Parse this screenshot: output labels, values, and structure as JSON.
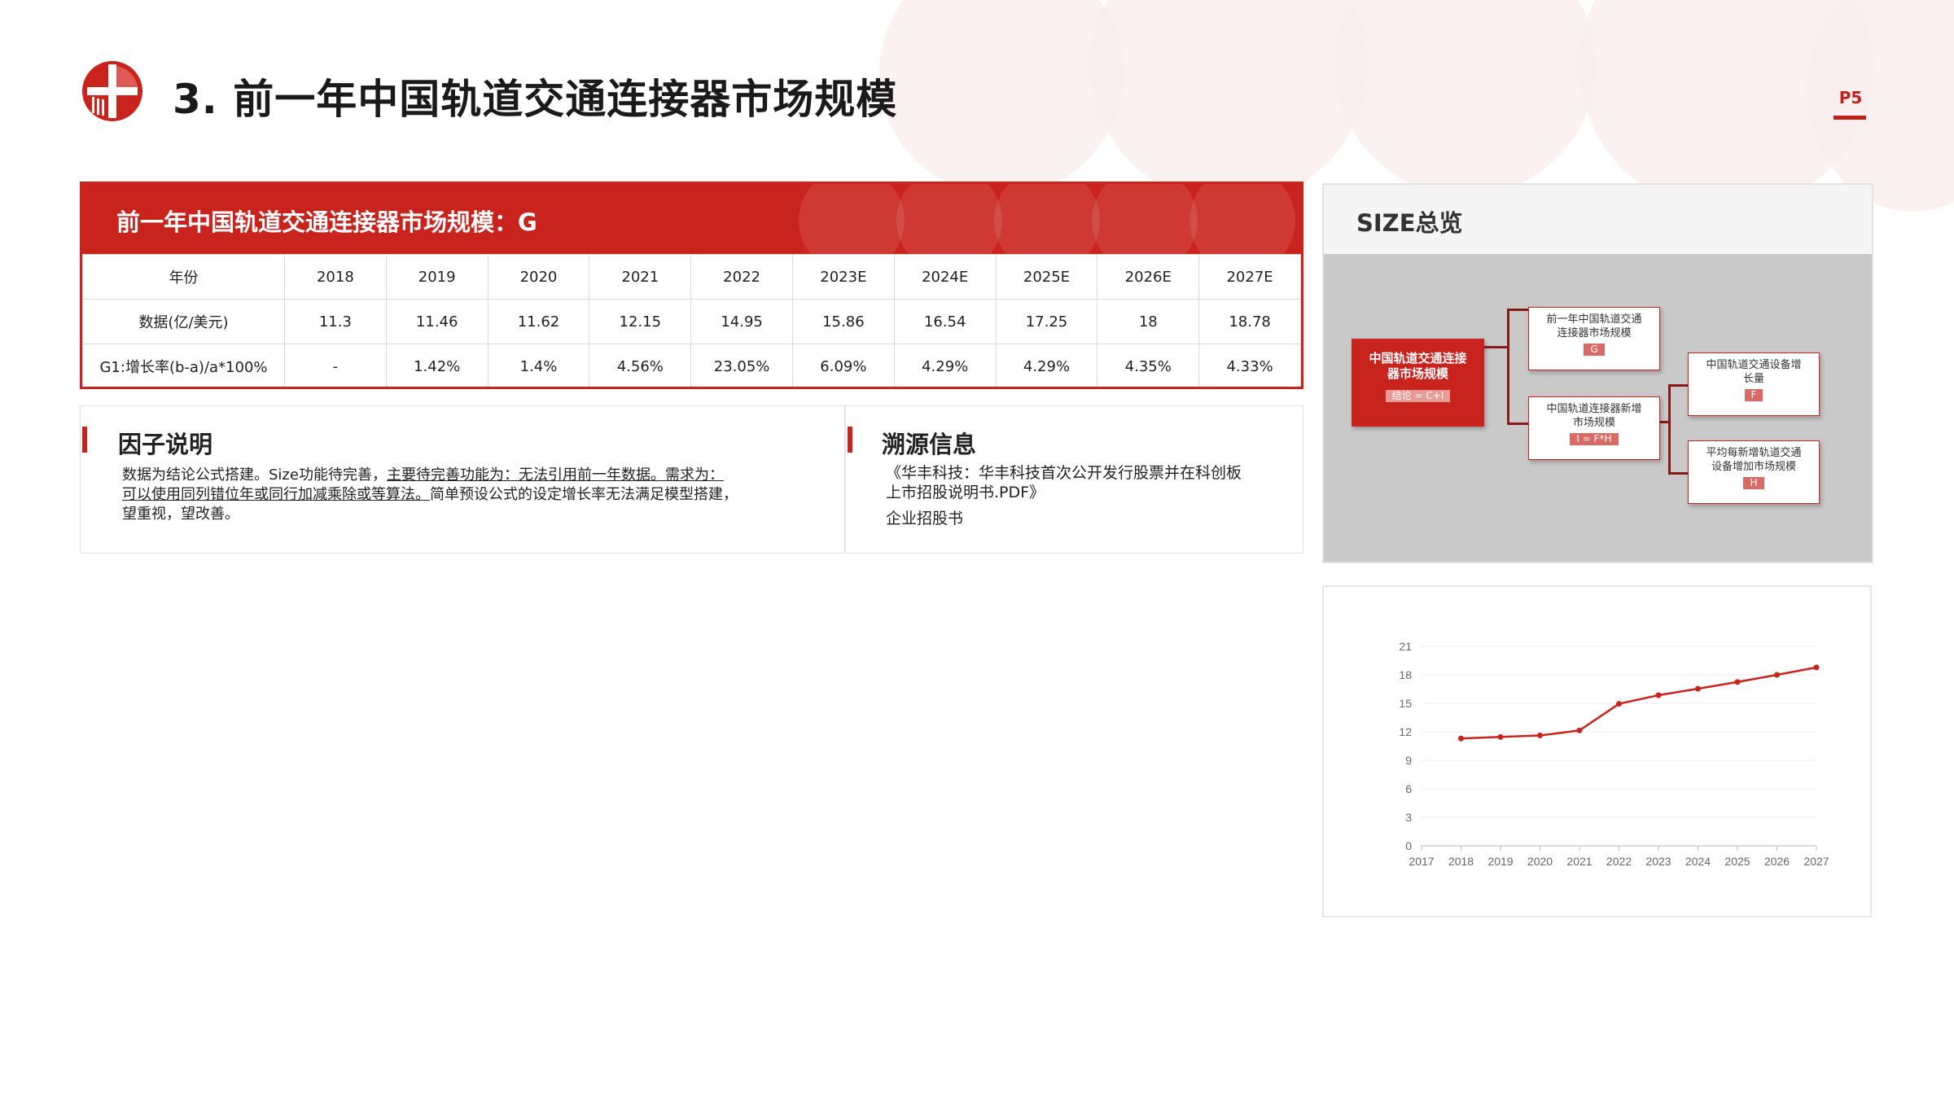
{
  "header": {
    "title": "3.  前一年中国轨道交通连接器市场规模",
    "page": "P5"
  },
  "table": {
    "heading": "前一年中国轨道交通连接器市场规模：G",
    "columns": [
      "年份",
      "2018",
      "2019",
      "2020",
      "2021",
      "2022",
      "2023E",
      "2024E",
      "2025E",
      "2026E",
      "2027E"
    ],
    "rows": [
      [
        "数据(亿/美元)",
        "11.3",
        "11.46",
        "11.62",
        "12.15",
        "14.95",
        "15.86",
        "16.54",
        "17.25",
        "18",
        "18.78"
      ],
      [
        "G1:增长率(b-a)/a*100%",
        "-",
        "1.42%",
        "1.4%",
        "4.56%",
        "23.05%",
        "6.09%",
        "4.29%",
        "4.29%",
        "4.35%",
        "4.33%"
      ]
    ]
  },
  "factor": {
    "title": "因子说明",
    "text_plain1": "数据为结论公式搭建。Size功能待完善，",
    "text_ul1": "主要待完善功能为：无法引用前一年数据。需求为：",
    "text_ul2": "可以使用同列错位年或同行加减乘除或等算法。",
    "text_plain2": "简单预设公式的设定增长率无法满足模型搭建，",
    "text_plain3": "望重视，望改善。"
  },
  "source": {
    "title": "溯源信息",
    "line1": "《华丰科技：华丰科技首次公开发行股票并在科创板",
    "line2": "上市招股说明书.PDF》",
    "line3": "企业招股书"
  },
  "size": {
    "title": "SIZE总览",
    "root": {
      "label1": "中国轨道交通连接",
      "label2": "器市场规模",
      "formula": "结论 = C+I"
    },
    "node_g": {
      "label1": "前一年中国轨道交通",
      "label2": "连接器市场规模",
      "formula": "G"
    },
    "node_i": {
      "label1": "中国轨道连接器新增",
      "label2": "市场规模",
      "formula": "I = F*H"
    },
    "node_f": {
      "label1": "中国轨道交通设备增",
      "label2": "长量",
      "formula": "F"
    },
    "node_h": {
      "label1": "平均每新增轨道交通",
      "label2": "设备增加市场规模",
      "formula": "H"
    }
  },
  "chart_data": {
    "type": "line",
    "x_ticks": [
      "2017",
      "2018",
      "2019",
      "2020",
      "2021",
      "2022",
      "2023",
      "2024",
      "2025",
      "2026",
      "2027"
    ],
    "y_ticks": [
      "0",
      "3",
      "6",
      "9",
      "12",
      "15",
      "18",
      "21"
    ],
    "x": [
      2018,
      2019,
      2020,
      2021,
      2022,
      2023,
      2024,
      2025,
      2026,
      2027
    ],
    "values": [
      11.3,
      11.46,
      11.62,
      12.15,
      14.95,
      15.86,
      16.54,
      17.25,
      18,
      18.78
    ],
    "xlim": [
      2017,
      2027
    ],
    "ylim": [
      0,
      21
    ],
    "grid": true,
    "color": "#c9231d"
  }
}
